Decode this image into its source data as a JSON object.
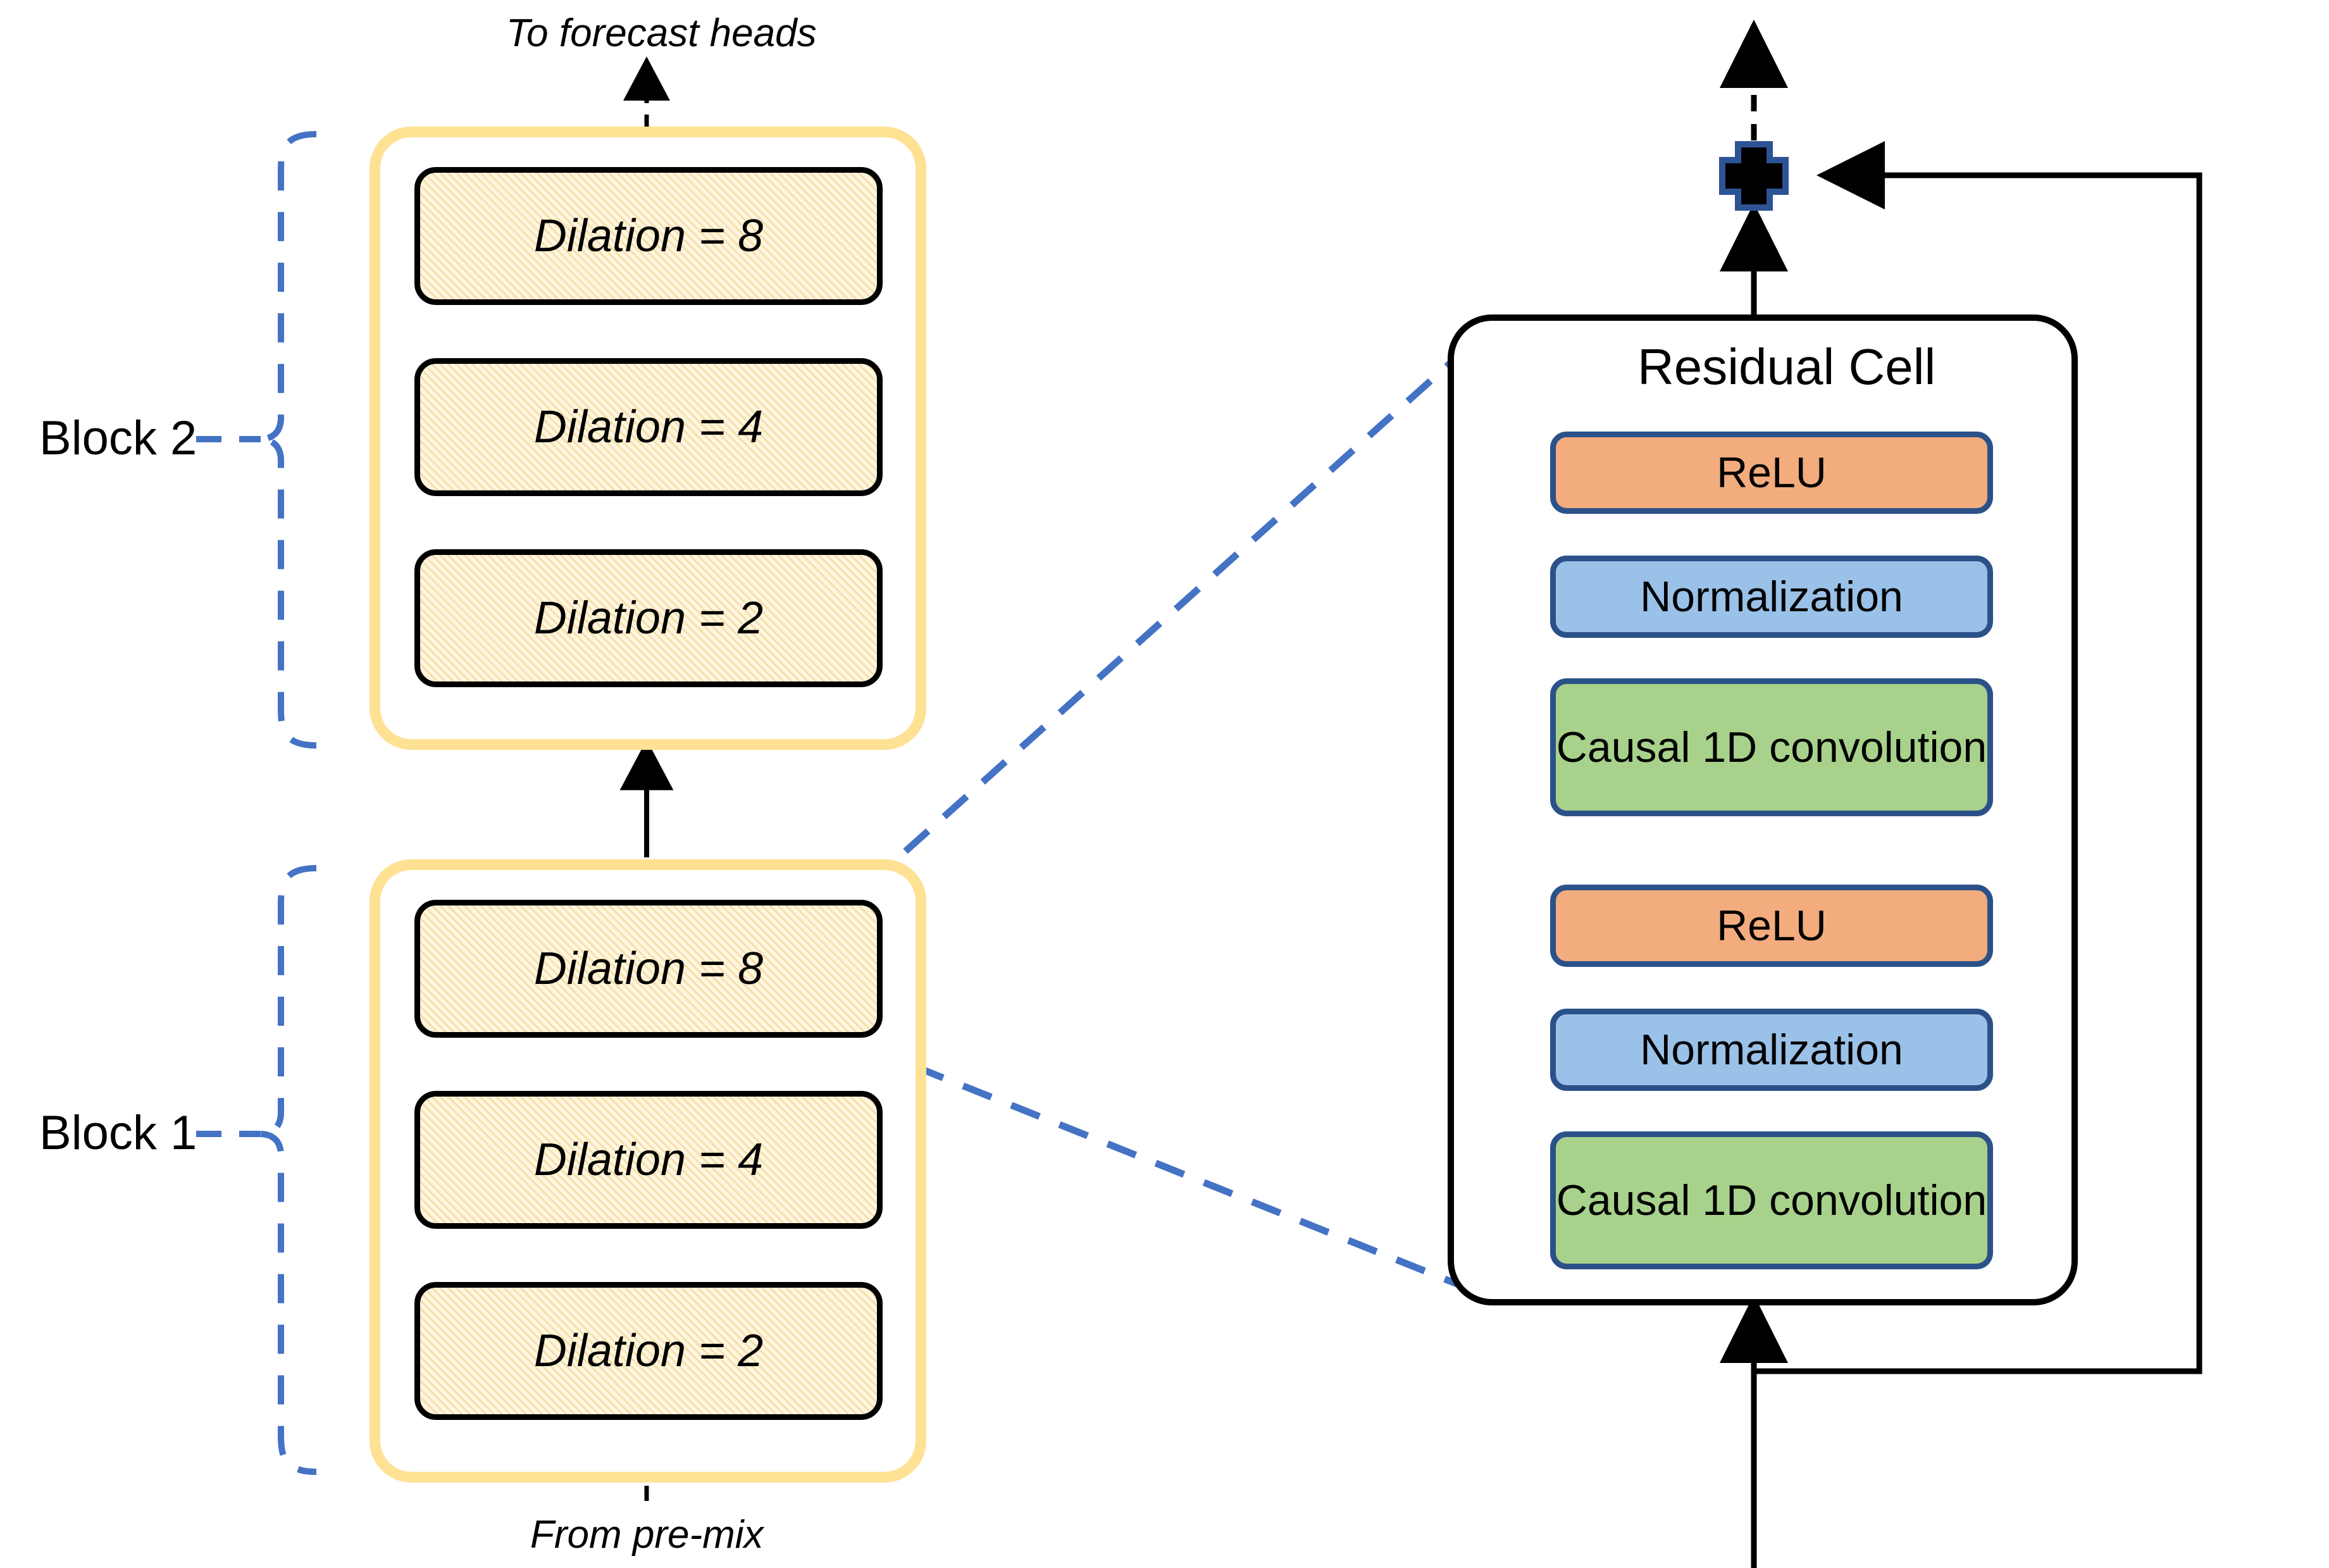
{
  "diagram": {
    "title": "Dilated causal convolution stack with residual cell detail",
    "colors": {
      "block_container_border": "#FFE194",
      "dilation_box_fill": "#FEF6E1",
      "dilation_box_hatch": "#F6DFA8",
      "dilation_box_border": "#000000",
      "relu_fill": "#F2AC7D",
      "normalization_fill": "#9AC1E8",
      "convolution_fill": "#A8D28B",
      "cell_item_border": "#2B5189",
      "brace_color": "#4472C4",
      "callout_color": "#4472C4",
      "arrow_color": "#000000",
      "plus_outline": "#2E5395"
    }
  },
  "flow": {
    "top_label": "To forecast heads",
    "bottom_label": "From pre-mix"
  },
  "blocks": [
    {
      "label": "Block 2",
      "layers": [
        {
          "label": "Dilation = 8",
          "dilation": 8
        },
        {
          "label": "Dilation = 4",
          "dilation": 4
        },
        {
          "label": "Dilation = 2",
          "dilation": 2
        }
      ]
    },
    {
      "label": "Block 1",
      "layers": [
        {
          "label": "Dilation = 8",
          "dilation": 8
        },
        {
          "label": "Dilation = 4",
          "dilation": 4
        },
        {
          "label": "Dilation = 2",
          "dilation": 2
        }
      ]
    }
  ],
  "residual_cell": {
    "title": "Residual Cell",
    "items": [
      {
        "label": "ReLU",
        "kind": "relu"
      },
      {
        "label": "Normalization",
        "kind": "norm"
      },
      {
        "label": "Causal 1D convolution",
        "kind": "conv"
      },
      {
        "label": "ReLU",
        "kind": "relu"
      },
      {
        "label": "Normalization",
        "kind": "norm"
      },
      {
        "label": "Causal 1D convolution",
        "kind": "conv"
      }
    ],
    "add_symbol": "+"
  }
}
